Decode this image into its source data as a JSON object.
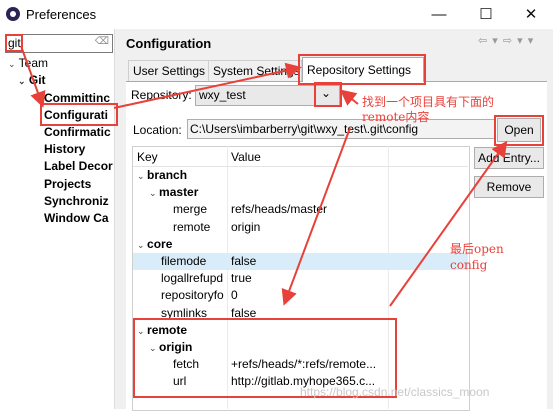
{
  "window": {
    "title": "Preferences",
    "minimize": "—",
    "maximize": "☐",
    "close": "✕"
  },
  "filter": {
    "value": "git",
    "clear": "⌫"
  },
  "tree": {
    "team": "Team",
    "git": "Git",
    "items": [
      "Committinc",
      "Configurati",
      "Confirmatic",
      "History",
      "Label Decor",
      "Projects",
      "Synchroniz",
      "Window Ca"
    ]
  },
  "page": {
    "title": "Configuration",
    "nav": "⇦ ▾ ⇨ ▾ ▾"
  },
  "tabs": [
    "User Settings",
    "System Settings",
    "Repository Settings"
  ],
  "repository": {
    "label": "Repository:",
    "value": "wxy_test",
    "drop": "⌄"
  },
  "location": {
    "label": "Location:",
    "value": "C:\\Users\\imbarberry\\git\\wxy_test\\.git\\config"
  },
  "buttons": {
    "open": "Open",
    "add_entry": "Add Entry...",
    "remove": "Remove"
  },
  "table": {
    "headers": [
      "Key",
      "Value"
    ],
    "rows": [
      {
        "key": "branch",
        "value": "",
        "arrow": "⌄",
        "bold": true
      },
      {
        "key": "master",
        "value": "",
        "arrow": "⌄",
        "bold": true
      },
      {
        "key": "merge",
        "value": "refs/heads/master"
      },
      {
        "key": "remote",
        "value": "origin"
      },
      {
        "key": "core",
        "value": "",
        "arrow": "⌄",
        "bold": true
      },
      {
        "key": "filemode",
        "value": "false"
      },
      {
        "key": "logallrefupd",
        "value": "true"
      },
      {
        "key": "repositoryfo",
        "value": "0"
      },
      {
        "key": "symlinks",
        "value": "false"
      },
      {
        "key": "remote",
        "value": "",
        "arrow": "⌄",
        "bold": true
      },
      {
        "key": "origin",
        "value": "",
        "arrow": "⌄",
        "bold": true
      },
      {
        "key": "fetch",
        "value": "+refs/heads/*:refs/remote..."
      },
      {
        "key": "url",
        "value": "http://gitlab.myhope365.c..."
      }
    ]
  },
  "annotations": {
    "note1_line1": "找到一个项目具有下面的",
    "note1_line2": "remote内容",
    "note2_line1": "最后open",
    "note2_line2": "config",
    "watermark": "https://blog.csdn.net/classics_moon"
  },
  "colors": {
    "annotation": "#e8413a",
    "highlight_row": "#d9ecfa",
    "background": "#f0f0f0"
  }
}
